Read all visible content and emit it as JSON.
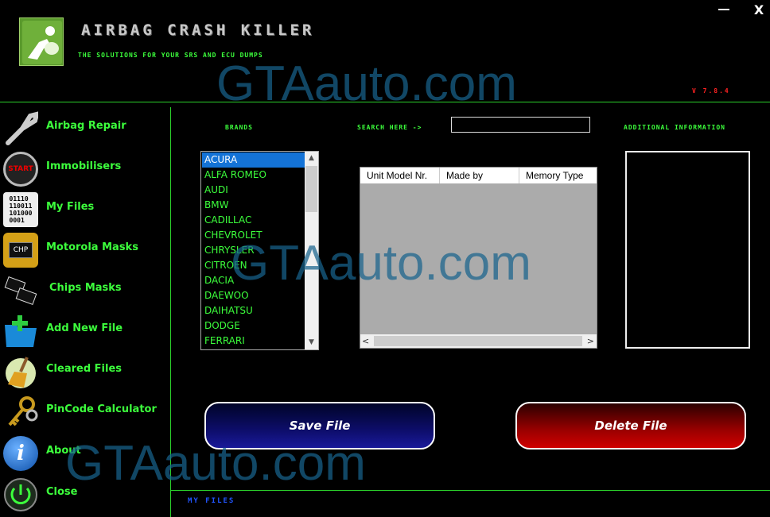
{
  "header": {
    "title": "AIRBAG CRASH KILLER",
    "subtitle": "THE SOLUTIONS FOR YOUR SRS AND ECU DUMPS",
    "version": "V 7.8.4",
    "close_glyph": "X"
  },
  "sidebar": {
    "items": [
      {
        "label": "Airbag Repair",
        "icon": "wrench-icon"
      },
      {
        "label": "Immobilisers",
        "icon": "start-button-icon",
        "icon_text": "START"
      },
      {
        "label": "My Files",
        "icon": "binary-file-icon",
        "icon_text": "01110\n110011\n101000\n0001"
      },
      {
        "label": "Motorola Masks",
        "icon": "chip-icon",
        "icon_text": "CHP"
      },
      {
        "label": "Chips Masks",
        "icon": "ic-chips-icon"
      },
      {
        "label": "Add New File",
        "icon": "add-folder-icon"
      },
      {
        "label": "Cleared Files",
        "icon": "broom-icon"
      },
      {
        "label": "PinCode Calculator",
        "icon": "keys-icon"
      },
      {
        "label": "About",
        "icon": "info-icon",
        "icon_text": "i"
      },
      {
        "label": "Close",
        "icon": "power-icon"
      }
    ]
  },
  "main": {
    "brands_label": "BRANDS",
    "search_label": "SEARCH HERE ->",
    "search_value": "",
    "additional_label": "ADDITIONAL INFORMATION",
    "brands": [
      "ACURA",
      "ALFA ROMEO",
      "AUDI",
      "BMW",
      "CADILLAC",
      "CHEVROLET",
      "CHRYSLER",
      "CITROEN",
      "DACIA",
      "DAEWOO",
      "DAIHATSU",
      "DODGE",
      "FERRARI"
    ],
    "selected_brand": "ACURA",
    "grid_columns": [
      "Unit Model Nr.",
      "Made by",
      "Memory Type"
    ],
    "save_button": "Save File",
    "delete_button": "Delete File",
    "status": "MY FILES"
  },
  "watermark": "GTAauto.com",
  "colors": {
    "accent_green": "#3cff3c",
    "line_green": "#2bd12b",
    "selection_blue": "#1473d7",
    "version_red": "#ff2222",
    "status_blue": "#2255ff"
  }
}
